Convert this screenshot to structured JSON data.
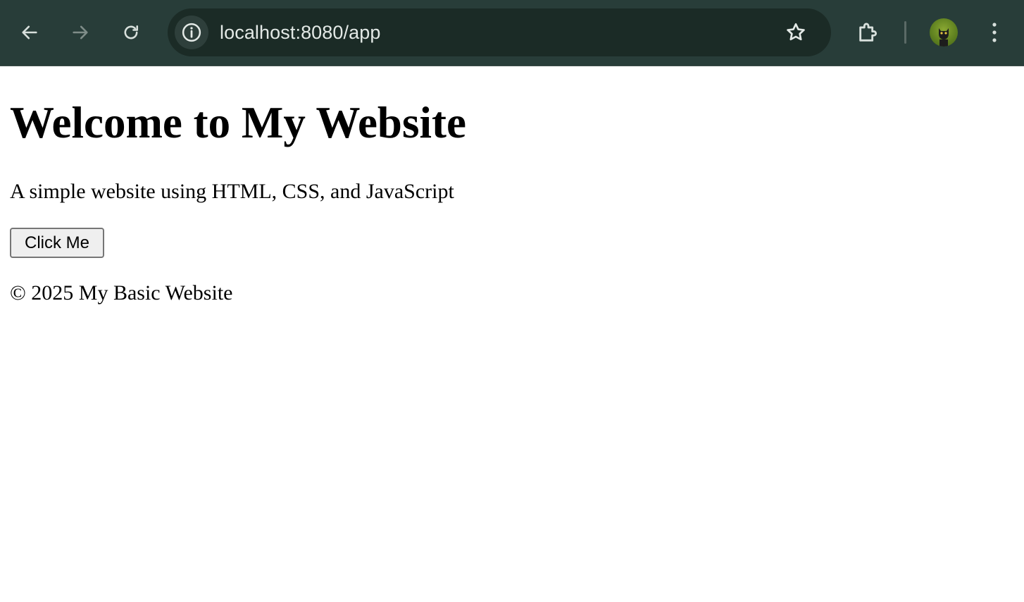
{
  "browser": {
    "url": "localhost:8080/app",
    "toolbar_color": "#283d39",
    "omnibox_color": "#1b2b26",
    "icons": {
      "back": "arrow-left-icon",
      "forward": "arrow-right-icon",
      "reload": "reload-icon",
      "site_info": "info-icon",
      "bookmark": "star-icon",
      "extensions": "puzzle-icon",
      "profile": "avatar",
      "menu": "kebab-menu-icon"
    }
  },
  "page": {
    "heading": "Welcome to My Website",
    "subtitle": "A simple website using HTML, CSS, and JavaScript",
    "button_label": "Click Me",
    "footer": "© 2025 My Basic Website"
  }
}
